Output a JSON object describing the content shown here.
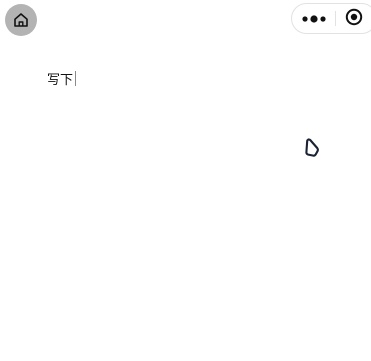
{
  "nav": {
    "home_icon": "home-icon",
    "more_icon": "more-dots-icon",
    "close_icon": "target-circle-icon"
  },
  "editor": {
    "text": "写下"
  },
  "tool": {
    "icon": "pen-nib-icon"
  },
  "colors": {
    "home_bg": "#b3b3b3",
    "icon_dark": "#111111",
    "capsule_border": "#e2e2e2",
    "tool_stroke": "#1a2233"
  }
}
